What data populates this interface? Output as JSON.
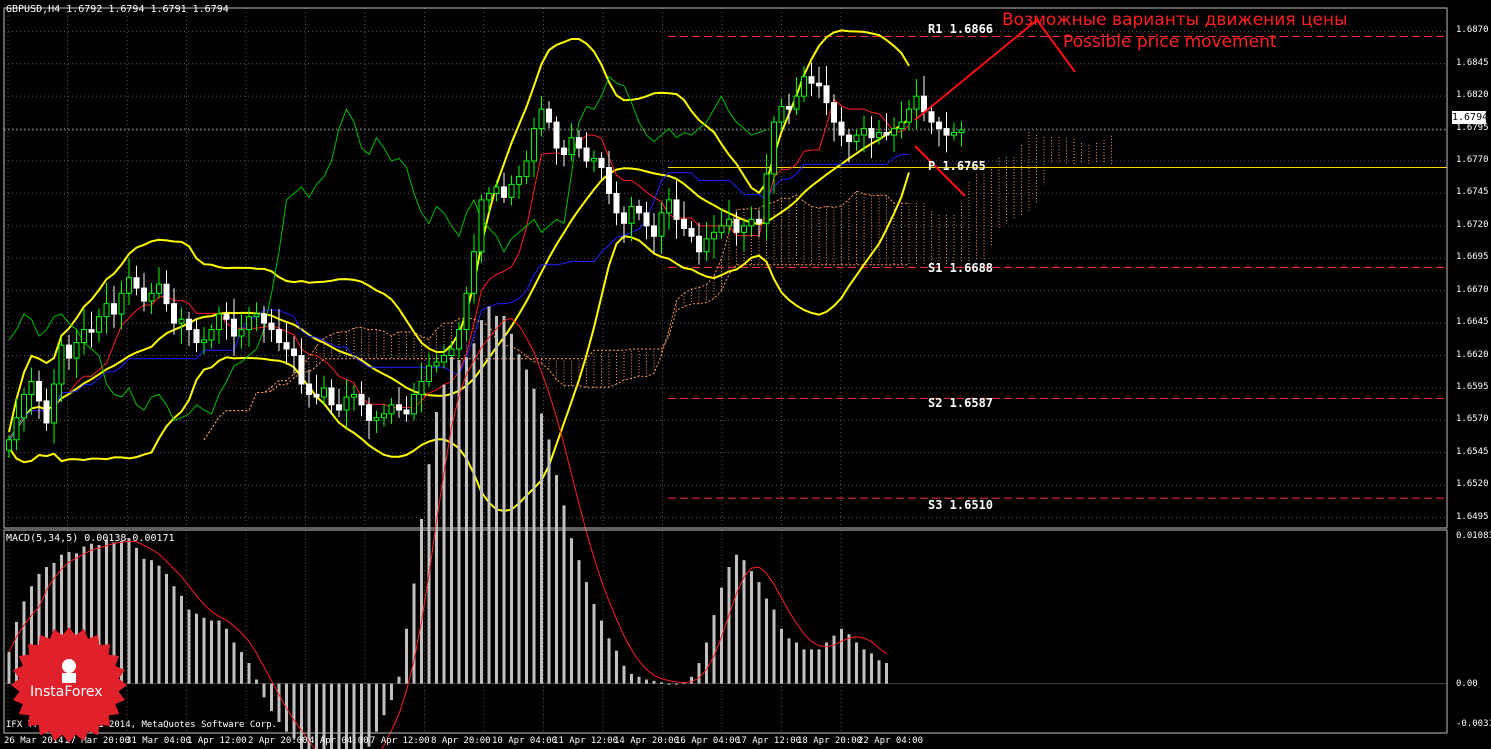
{
  "window": {
    "symbol_header": "GBPUSD,H4 1.6792 1.6794 1.6791 1.6794",
    "macd_header": "MACD(5,34,5) 0.00138 0.00171",
    "copyright": "IFX Trader, © 2001-2014, MetaQuotes Software Corp.",
    "current_price": "1.6794"
  },
  "annotations": {
    "russian": "Возможные варианты движения цены",
    "english": "Possible price movement"
  },
  "pivots": [
    {
      "label": "R1 1.6866",
      "value": 1.6866,
      "color": "#ff3030"
    },
    {
      "label": "P 1.6765",
      "value": 1.6765,
      "color": "#ffd700"
    },
    {
      "label": "S1 1.6688",
      "value": 1.6688,
      "color": "#ff3030"
    },
    {
      "label": "S2 1.6587",
      "value": 1.6587,
      "color": "#ff3030"
    },
    {
      "label": "S3 1.6510",
      "value": 1.651,
      "color": "#ff3030"
    }
  ],
  "logo": {
    "text": "InstaForex",
    "color": "#e0202a"
  },
  "colors": {
    "bull_candle": "#00ff00",
    "bear_candle": "#ffffff",
    "bollinger": "#ffff00",
    "tenkan": "#ff2020",
    "kijun": "#2020ff",
    "chikou": "#00c000",
    "cloud": "#ff9955",
    "macd_bars": "#c0c0c0",
    "macd_signal": "#ff2020",
    "grid": "#5a5a5a"
  },
  "chart_data": [
    {
      "type": "candlestick",
      "title": "GBPUSD,H4",
      "ylim": [
        1.6487,
        1.6888
      ],
      "y_ticks": [
        "1.6870",
        "1.6845",
        "1.6820",
        "1.6795",
        "1.6770",
        "1.6745",
        "1.6720",
        "1.6695",
        "1.6670",
        "1.6645",
        "1.6620",
        "1.6595",
        "1.6570",
        "1.6545",
        "1.6520",
        "1.6495"
      ],
      "x_ticks": [
        "26 Mar 2014",
        "27 Mar 20:00",
        "31 Mar 04:00",
        "1 Apr 12:00",
        "2 Apr 20:00",
        "4 Apr 04:00",
        "7 Apr 12:00",
        "8 Apr 20:00",
        "10 Apr 04:00",
        "11 Apr 12:00",
        "14 Apr 20:00",
        "16 Apr 04:00",
        "17 Apr 12:00",
        "18 Apr 20:00",
        "22 Apr 04:00"
      ],
      "close": [
        1.6555,
        1.6572,
        1.659,
        1.66,
        1.6585,
        1.6568,
        1.6598,
        1.6628,
        1.6618,
        1.663,
        1.664,
        1.6638,
        1.665,
        1.666,
        1.6652,
        1.6668,
        1.668,
        1.6672,
        1.6662,
        1.6668,
        1.6675,
        1.666,
        1.6645,
        1.6648,
        1.664,
        1.663,
        1.6632,
        1.664,
        1.6652,
        1.6648,
        1.6635,
        1.664,
        1.665,
        1.6652,
        1.6645,
        1.664,
        1.663,
        1.6625,
        1.662,
        1.6598,
        1.659,
        1.6588,
        1.6595,
        1.6582,
        1.6578,
        1.6588,
        1.659,
        1.6582,
        1.657,
        1.6572,
        1.6575,
        1.6582,
        1.6578,
        1.6575,
        1.659,
        1.66,
        1.6612,
        1.6615,
        1.662,
        1.6625,
        1.664,
        1.6668,
        1.67,
        1.674,
        1.6745,
        1.675,
        1.6742,
        1.6752,
        1.6758,
        1.677,
        1.6795,
        1.681,
        1.68,
        1.678,
        1.6775,
        1.6788,
        1.678,
        1.677,
        1.6772,
        1.6765,
        1.6745,
        1.673,
        1.6722,
        1.6735,
        1.673,
        1.672,
        1.6712,
        1.673,
        1.674,
        1.6725,
        1.6718,
        1.6712,
        1.67,
        1.671,
        1.6715,
        1.672,
        1.6725,
        1.6715,
        1.672,
        1.6725,
        1.6722,
        1.676,
        1.68,
        1.6812,
        1.681,
        1.682,
        1.6835,
        1.683,
        1.6828,
        1.6815,
        1.68,
        1.679,
        1.6785,
        1.679,
        1.6795,
        1.6788,
        1.6792,
        1.679,
        1.6795,
        1.68,
        1.681,
        1.682,
        1.6808,
        1.68,
        1.6795,
        1.679,
        1.6792,
        1.6794
      ],
      "macd": [
        0.00023,
        0.00045,
        0.0006,
        0.00071,
        0.0008,
        0.00085,
        0.00088,
        0.00094,
        0.00096,
        0.00095,
        0.001,
        0.00102,
        0.00101,
        0.00105,
        0.00103,
        0.00104,
        0.00106,
        0.00099,
        0.00091,
        0.0009,
        0.00086,
        0.0008,
        0.00071,
        0.00064,
        0.00054,
        0.00051,
        0.00048,
        0.00046,
        0.00046,
        0.0004,
        0.0003,
        0.00023,
        0.00015,
        3e-05,
        -0.0001,
        -0.0002,
        -0.00028,
        -0.00035,
        -0.0004,
        -0.00048,
        -0.00058,
        -0.00066,
        -0.0007,
        -0.00072,
        -0.00073,
        -0.00071,
        -0.00066,
        -0.00055,
        -0.00046,
        -0.00035,
        -0.00023,
        -0.00012,
        5e-05,
        0.0004,
        0.00073,
        0.0012,
        0.0016,
        0.00198,
        0.00218,
        0.00238,
        0.00236,
        0.00238,
        0.00248,
        0.00265,
        0.00275,
        0.00268,
        0.00268,
        0.00255,
        0.0024,
        0.00229,
        0.00215,
        0.00197,
        0.00178,
        0.00152,
        0.0013,
        0.00106,
        0.0009,
        0.00074,
        0.00058,
        0.00046,
        0.00033,
        0.00024,
        0.00013,
        7e-05,
        5e-05,
        3e-05,
        2e-05,
        1e-05,
        0.0,
        0.0,
        1e-05,
        5e-05,
        0.00015,
        0.0003,
        0.0005,
        0.0007,
        0.00085,
        0.00094,
        0.0009,
        0.00082,
        0.00074,
        0.00062,
        0.00054,
        0.0004,
        0.00033,
        0.0003,
        0.00025,
        0.00025,
        0.00025,
        0.0003,
        0.00035,
        0.0004,
        0.00036,
        0.0003,
        0.00025,
        0.00022,
        0.00017,
        0.00015
      ],
      "macd_ylim": [
        -0.00036,
        0.00112
      ],
      "macd_y_ticks": [
        "0.01083",
        "0.00",
        "-0.00319"
      ]
    }
  ]
}
